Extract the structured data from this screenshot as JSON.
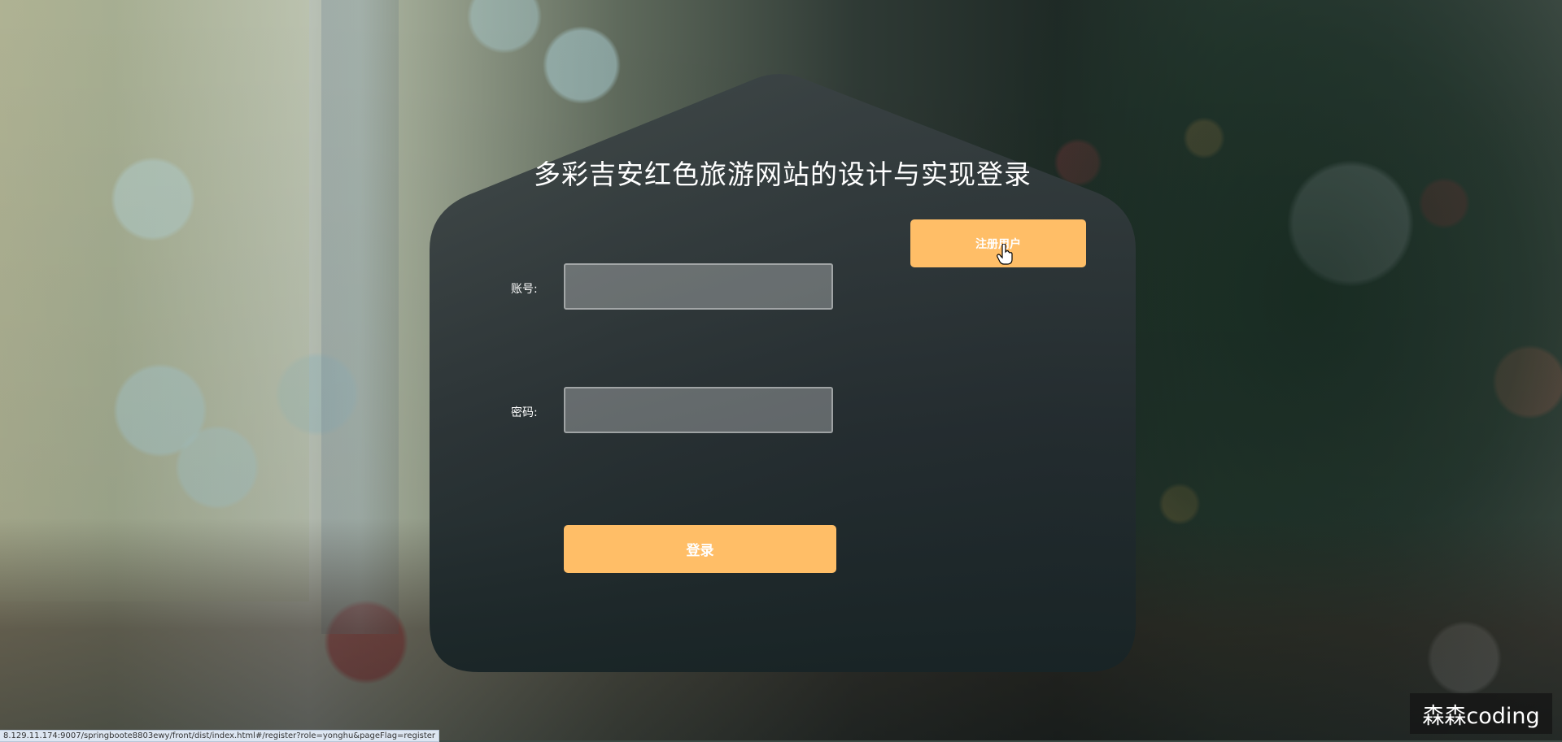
{
  "login": {
    "title": "多彩吉安红色旅游网站的设计与实现登录",
    "register_button": "注册用户",
    "account_label": "账号:",
    "account_value": "",
    "account_placeholder": "",
    "password_label": "密码:",
    "password_value": "",
    "password_placeholder": "",
    "login_button": "登录"
  },
  "status_bar": {
    "url": "8.129.11.174:9007/springboote8803ewy/front/dist/index.html#/register?role=yonghu&pageFlag=register"
  },
  "watermark": {
    "text": "森森coding"
  },
  "colors": {
    "accent": "#ffbe67",
    "panel": "#2a3336"
  }
}
